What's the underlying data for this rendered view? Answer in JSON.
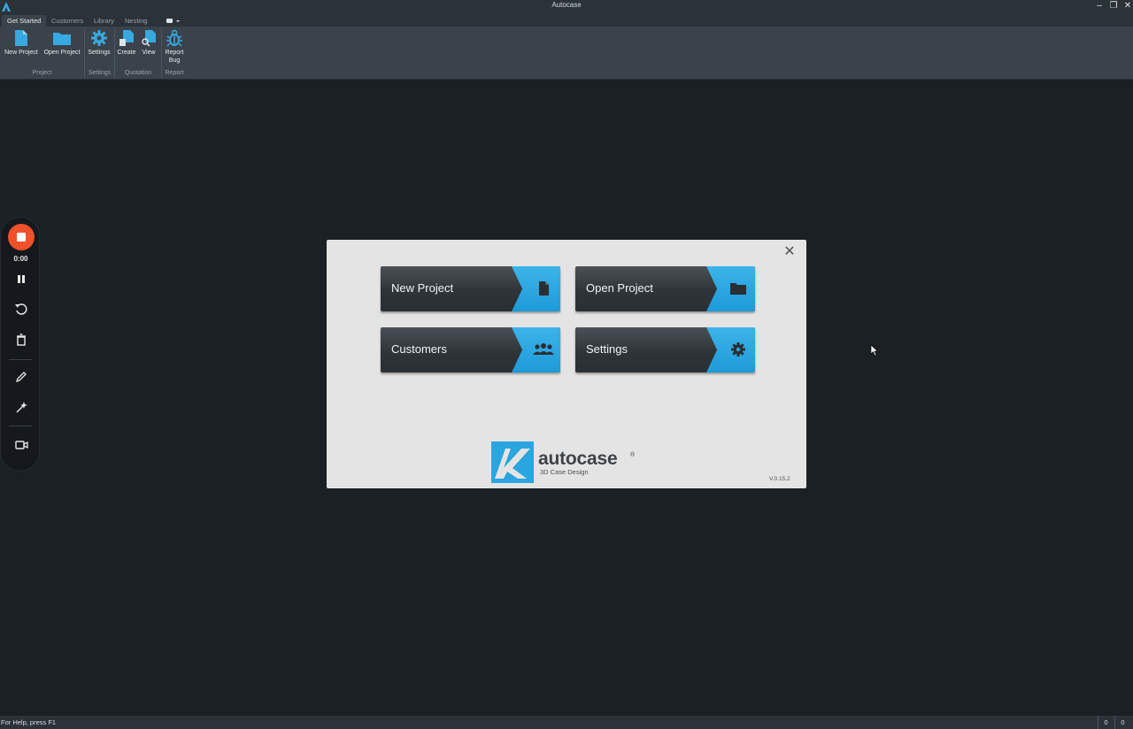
{
  "window": {
    "title": "Autocase"
  },
  "tabs": [
    {
      "label": "Get Started",
      "active": true
    },
    {
      "label": "Customers",
      "active": false
    },
    {
      "label": "Library",
      "active": false
    },
    {
      "label": "Nesting",
      "active": false
    }
  ],
  "ribbon": {
    "buttons": {
      "new_project": {
        "label": "New Project",
        "icon": "new-file-icon"
      },
      "open_project": {
        "label": "Open Project",
        "icon": "folder-icon"
      },
      "settings": {
        "label": "Settings",
        "icon": "gear-icon"
      },
      "create": {
        "label": "Create",
        "icon": "create-document-icon"
      },
      "view": {
        "label": "View",
        "icon": "view-document-icon"
      },
      "report_bug": {
        "label": "Report Bug",
        "icon": "bug-icon"
      }
    },
    "groups": {
      "project": "Project",
      "settings": "Settings",
      "quotation": "Quotation",
      "report": "Report"
    }
  },
  "recorder": {
    "time": "0:00"
  },
  "dialog": {
    "buttons": {
      "new_project": "New Project",
      "open_project": "Open Project",
      "customers": "Customers",
      "settings": "Settings"
    },
    "logo": {
      "name": "autocase",
      "registered": "®",
      "tagline": "3D Case Design"
    },
    "version": "V.0.15.2"
  },
  "statusbar": {
    "help": "For Help, press F1",
    "pane1": "0",
    "pane2": "0"
  },
  "colors": {
    "accent": "#1e9ad8",
    "record": "#f0502a",
    "background": "#1b2025"
  }
}
